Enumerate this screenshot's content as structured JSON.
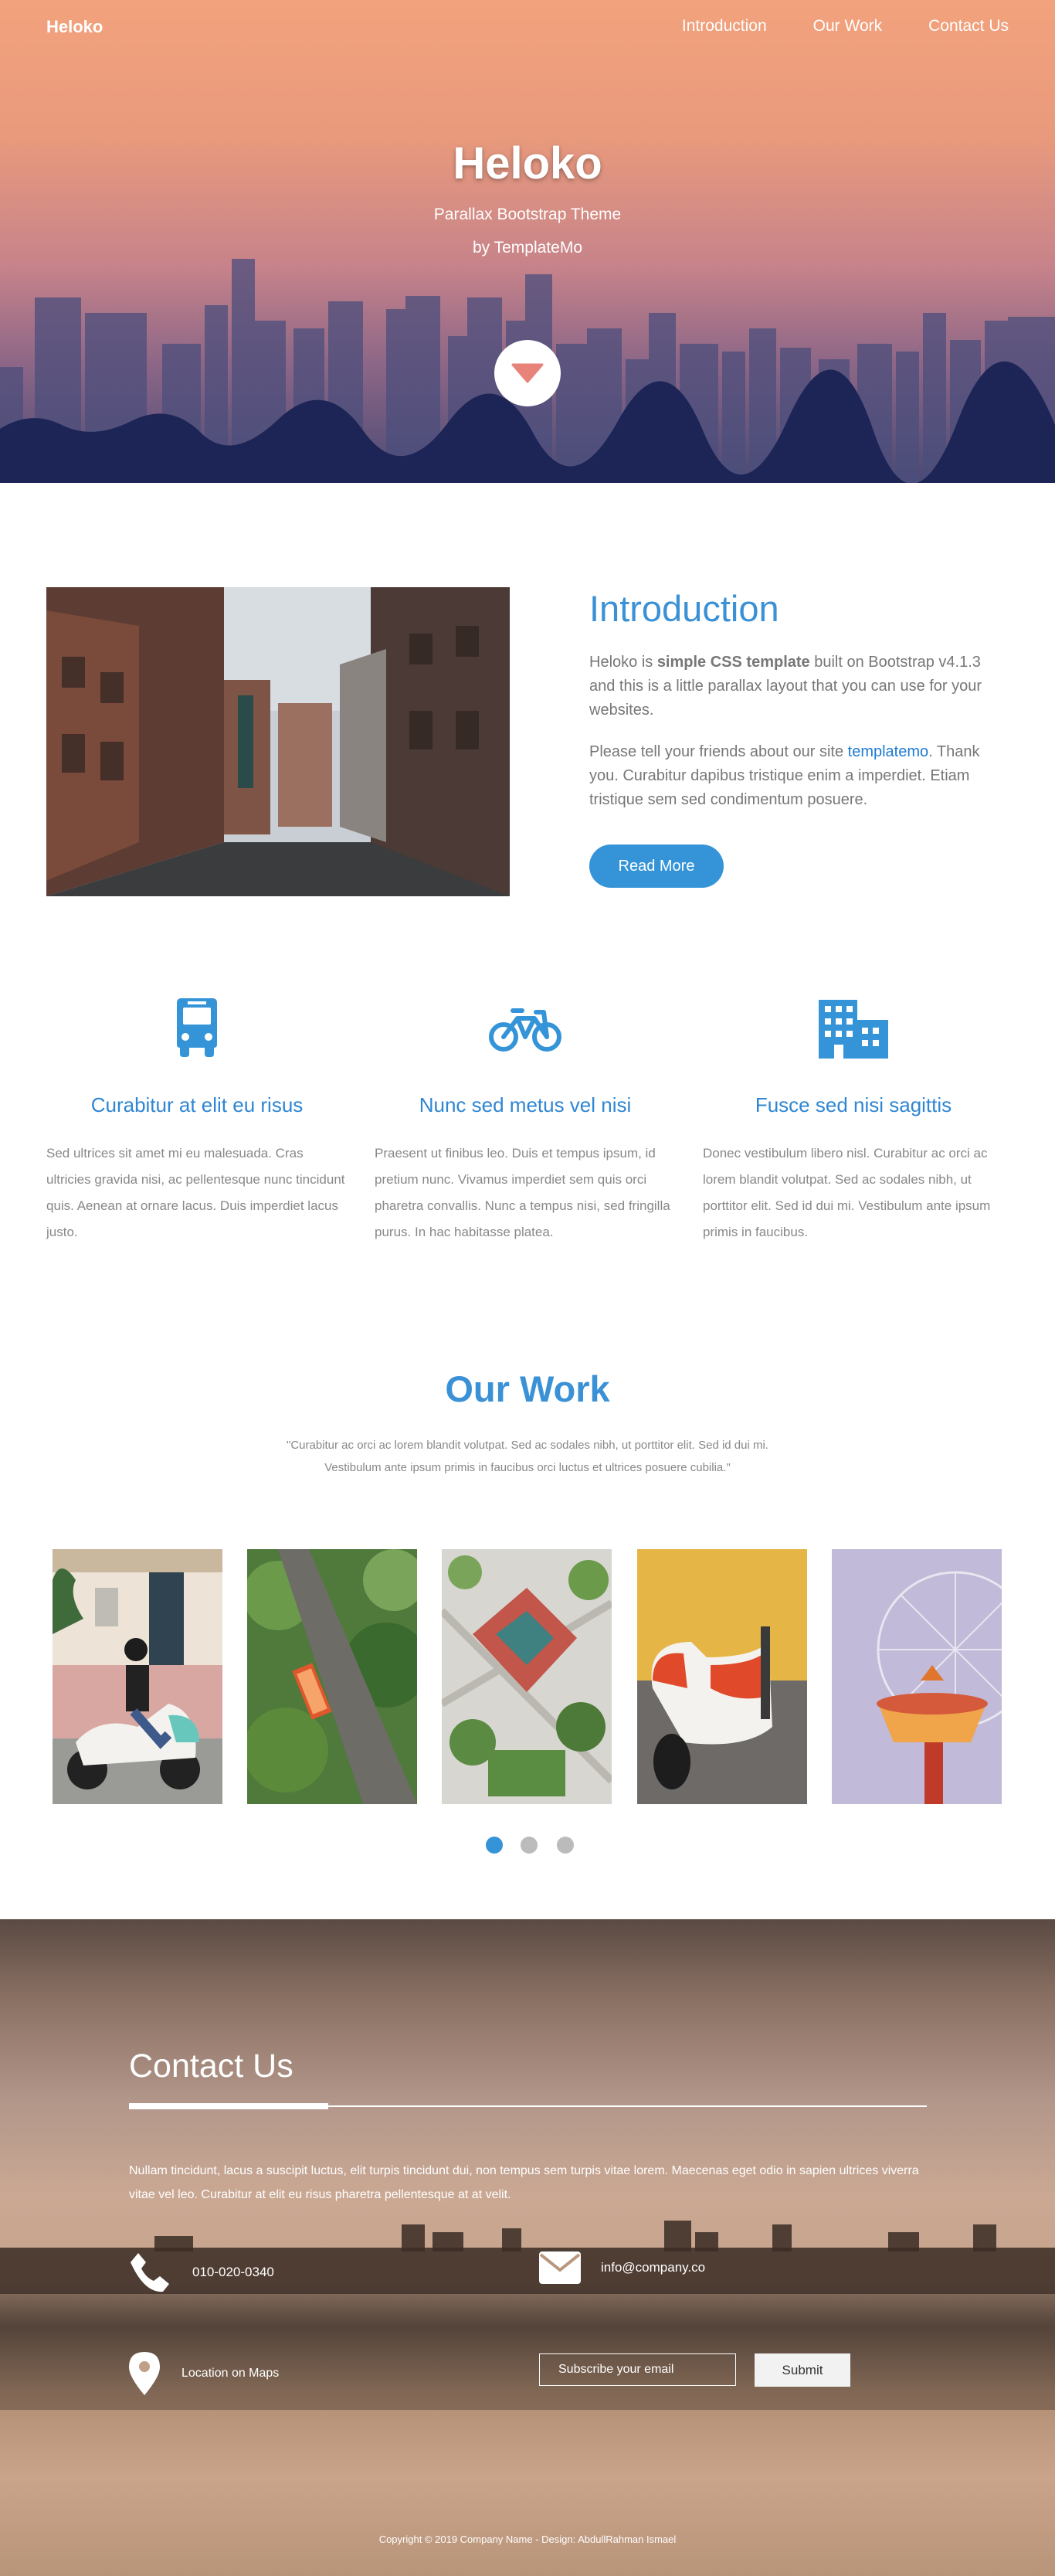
{
  "nav": {
    "brand": "Heloko",
    "links": [
      "Introduction",
      "Our Work",
      "Contact Us"
    ]
  },
  "hero": {
    "title": "Heloko",
    "subtitle": "Parallax Bootstrap Theme",
    "byline": "by TemplateMo",
    "scroll_icon": "caret-down-icon"
  },
  "intro": {
    "title": "Introduction",
    "p1_a": "Heloko is ",
    "p1_bold": "simple CSS template",
    "p1_b": " built on Bootstrap v4.1.3 and this is a little parallax layout that you can use for your websites.",
    "p2_a": "Please tell your friends about our site ",
    "p2_link": "templatemo",
    "p2_b": ". Thank you. Curabitur dapibus tristique enim a imperdiet. Etiam tristique sem sed condimentum posuere.",
    "button": "Read More"
  },
  "features": [
    {
      "icon": "bus-icon",
      "title": "Curabitur at elit eu risus",
      "text": "Sed ultrices sit amet mi eu malesuada. Cras ultricies gravida nisi, ac pellentesque nunc tincidunt quis. Aenean at ornare lacus. Duis imperdiet lacus justo."
    },
    {
      "icon": "bicycle-icon",
      "title": "Nunc sed metus vel nisi",
      "text": "Praesent ut finibus leo. Duis et tempus ipsum, id pretium nunc. Vivamus imperdiet sem quis orci pharetra convallis. Nunc a tempus nisi, sed fringilla purus. In hac habitasse platea."
    },
    {
      "icon": "building-icon",
      "title": "Fusce sed nisi sagittis",
      "text": "Donec vestibulum libero nisl. Curabitur ac orci ac lorem blandit volutpat. Sed ac sodales nibh, ut porttitor elit. Sed id dui mi. Vestibulum ante ipsum primis in faucibus."
    }
  ],
  "work": {
    "title": "Our Work",
    "quote": "\"Curabitur ac orci ac lorem blandit volutpat. Sed ac sodales nibh, ut porttitor elit. Sed id dui mi. Vestibulum ante ipsum primis in faucibus orci luctus et ultrices posuere cubilia.\"",
    "active_dot": 0
  },
  "contact": {
    "title": "Contact Us",
    "text": "Nullam tincidunt, lacus a suscipit luctus, elit turpis tincidunt dui, non tempus sem turpis vitae lorem. Maecenas eget odio in sapien ultrices viverra vitae vel leo. Curabitur at elit eu risus pharetra pellentesque at at velit.",
    "phone": "010-020-0340",
    "email": "info@company.co",
    "maps": "Location on Maps",
    "subscribe_placeholder": "Subscribe your email",
    "submit": "Submit"
  },
  "footer": {
    "copyright": "Copyright © 2019 Company Name - Design: AbdullRahman Ismael"
  },
  "colors": {
    "accent": "#3594d8",
    "heading_blue": "#3b91d6"
  }
}
